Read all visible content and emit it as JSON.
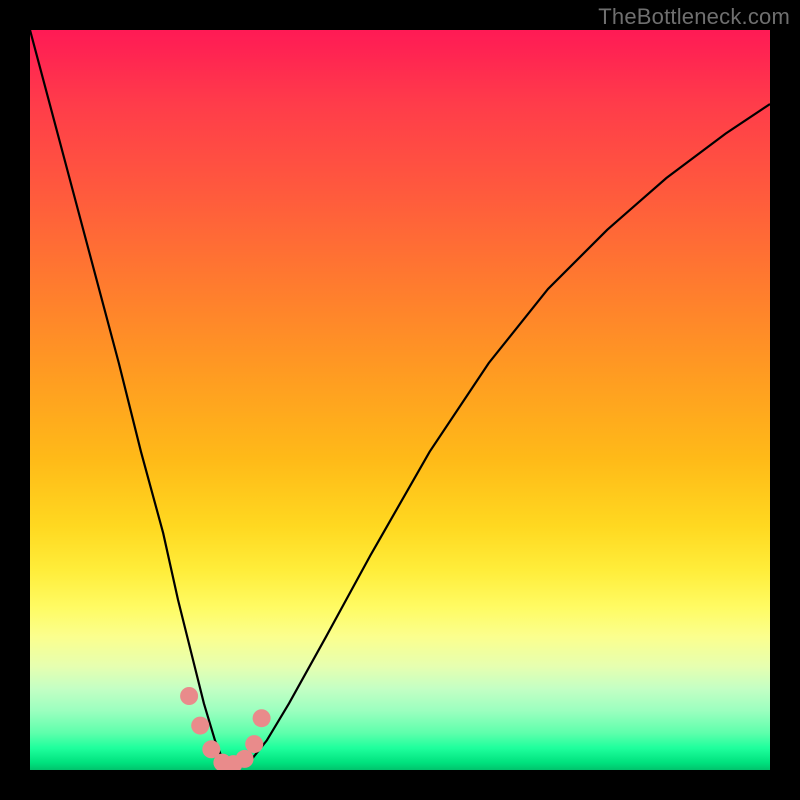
{
  "watermark": "TheBottleneck.com",
  "colors": {
    "frame": "#000000",
    "curve": "#000000",
    "marker": "#e98b8b"
  },
  "chart_data": {
    "type": "line",
    "title": "",
    "xlabel": "",
    "ylabel": "",
    "xlim": [
      0,
      100
    ],
    "ylim": [
      0,
      100
    ],
    "grid": false,
    "series": [
      {
        "name": "bottleneck-curve",
        "x": [
          0,
          4,
          8,
          12,
          15,
          18,
          20,
          22,
          23.5,
          25,
          26,
          27,
          28.5,
          30,
          32,
          35,
          40,
          46,
          54,
          62,
          70,
          78,
          86,
          94,
          100
        ],
        "values": [
          100,
          85,
          70,
          55,
          43,
          32,
          23,
          15,
          9,
          4,
          1.5,
          0.5,
          0.5,
          1.5,
          4,
          9,
          18,
          29,
          43,
          55,
          65,
          73,
          80,
          86,
          90
        ]
      }
    ],
    "markers": {
      "name": "highlight-points",
      "x": [
        21.5,
        23.0,
        24.5,
        26.0,
        27.5,
        29.0,
        30.3,
        31.3
      ],
      "values": [
        10.0,
        6.0,
        2.8,
        1.0,
        0.8,
        1.5,
        3.5,
        7.0
      ]
    }
  }
}
